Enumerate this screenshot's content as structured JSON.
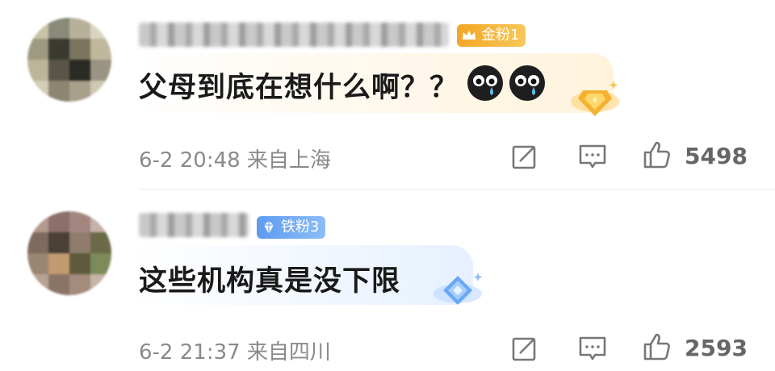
{
  "comments": [
    {
      "badge": "金粉1",
      "text": "父母到底在想什么啊？？",
      "meta": "6-2 20:48 来自上海",
      "likes": "5498"
    },
    {
      "badge": "铁粉3",
      "text": "这些机构真是没下限",
      "meta": "6-2 21:37 来自四川",
      "likes": "2593"
    }
  ],
  "icons": {
    "emoji": "crying-face-icon",
    "share": "share-icon",
    "reply": "comment-icon",
    "like": "thumbs-up-icon",
    "gold_badge": "crown-badge-icon",
    "iron_badge": "diamond-badge-icon"
  },
  "colors": {
    "gold_badge": "#f4a626",
    "iron_badge": "#5e9bf0",
    "meta_text": "#8a8a8a"
  }
}
